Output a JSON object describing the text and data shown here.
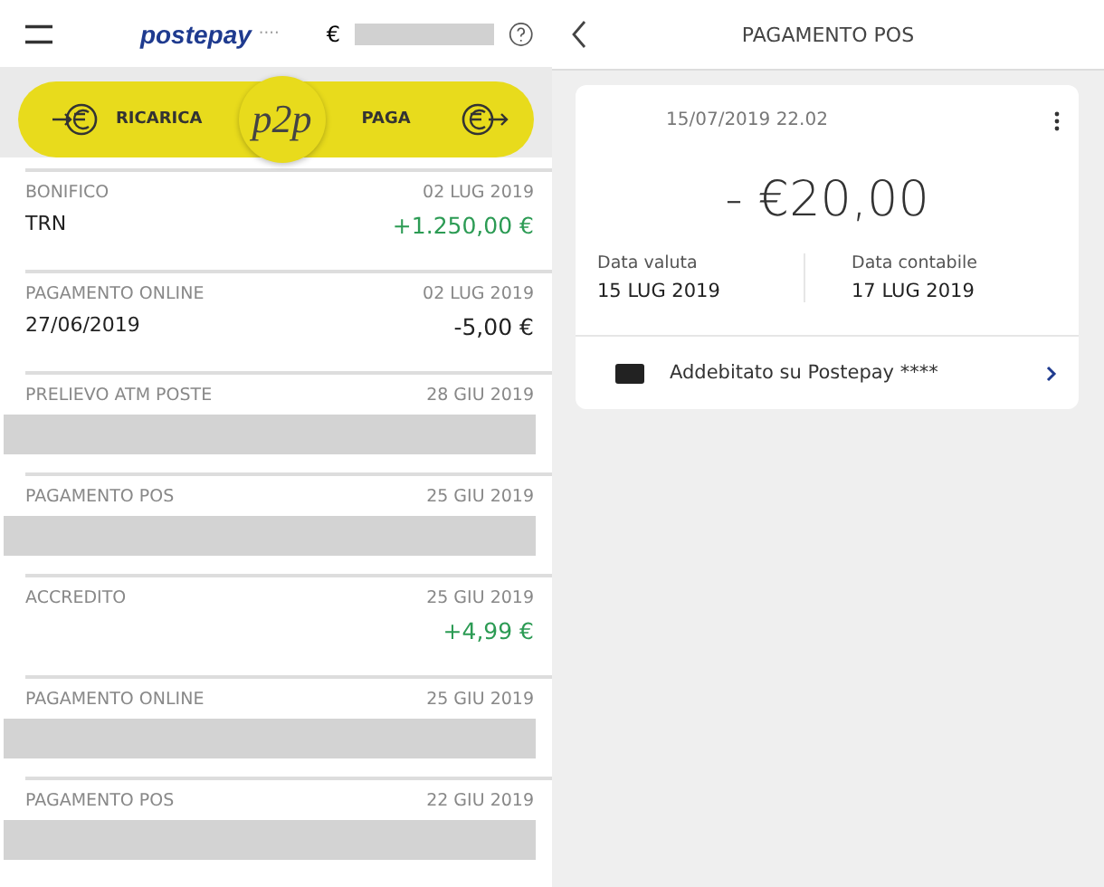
{
  "header": {
    "logo": "postepay",
    "logo_mask": "····",
    "currency": "€"
  },
  "actions": {
    "recharge": "RICARICA",
    "center": "p2p",
    "pay": "PAGA"
  },
  "transactions": [
    {
      "type": "BONIFICO",
      "date": "02 LUG 2019",
      "detail": "TRN",
      "amount": "+1.250,00 €",
      "kind": "credit",
      "redacted": false
    },
    {
      "type": "PAGAMENTO ONLINE",
      "date": "02 LUG 2019",
      "detail": "27/06/2019",
      "amount": "-5,00 €",
      "kind": "debit",
      "redacted": false
    },
    {
      "type": "PRELIEVO ATM POSTE",
      "date": "28 GIU 2019",
      "redacted": true
    },
    {
      "type": "PAGAMENTO POS",
      "date": "25 GIU 2019",
      "redacted": true
    },
    {
      "type": "ACCREDITO",
      "date": "25 GIU 2019",
      "amount": "+4,99 €",
      "kind": "credit",
      "redacted": false
    },
    {
      "type": "PAGAMENTO ONLINE",
      "date": "25 GIU 2019",
      "redacted": true
    },
    {
      "type": "PAGAMENTO POS",
      "date": "22 GIU 2019",
      "redacted": true
    }
  ],
  "detail": {
    "title": "PAGAMENTO POS",
    "datetime": "15/07/2019 22.02",
    "amount": "- €20,00",
    "dates": [
      {
        "label": "Data valuta",
        "value": "15 LUG 2019"
      },
      {
        "label": "Data contabile",
        "value": "17 LUG 2019"
      }
    ],
    "charged_on": "Addebitato su Postepay ****"
  }
}
